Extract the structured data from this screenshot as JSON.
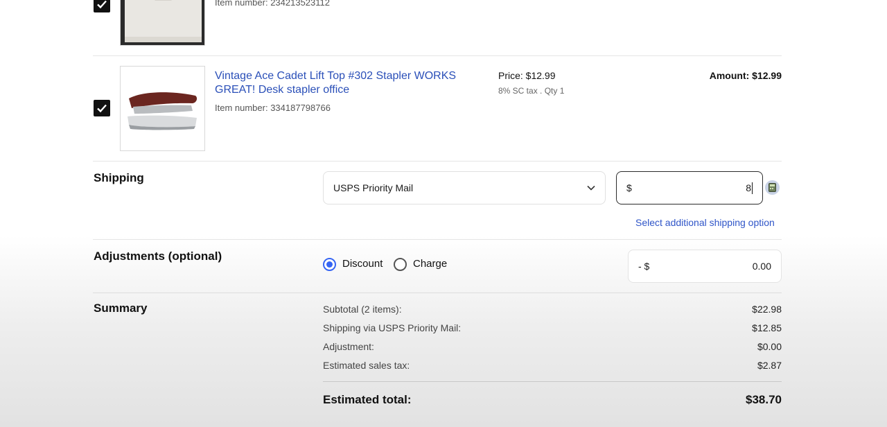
{
  "items": [
    {
      "item_number": "Item number: 234213523112",
      "checked": true
    },
    {
      "title": "Vintage Ace Cadet Lift Top #302 Stapler WORKS GREAT! Desk stapler office",
      "item_number": "Item number: 334187798766",
      "price": "Price: $12.99",
      "tax": "8% SC tax . Qty 1",
      "amount": "Amount: $12.99",
      "checked": true
    }
  ],
  "shipping": {
    "label": "Shipping",
    "service": "USPS Priority Mail",
    "currency": "$",
    "cost_value": "8",
    "additional_link": "Select additional shipping option"
  },
  "adjustments": {
    "label": "Adjustments (optional)",
    "discount_label": "Discount",
    "charge_label": "Charge",
    "selected": "Discount",
    "prefix": "- $",
    "value": "0.00"
  },
  "summary": {
    "label": "Summary",
    "rows": [
      {
        "label": "Subtotal (2 items):",
        "value": "$22.98"
      },
      {
        "label": "Shipping via USPS Priority Mail:",
        "value": "$12.85"
      },
      {
        "label": "Adjustment:",
        "value": "$0.00"
      },
      {
        "label": "Estimated sales tax:",
        "value": "$2.87"
      }
    ],
    "total_label": "Estimated total:",
    "total_value": "$38.70"
  },
  "colors": {
    "link": "#3665f3",
    "radio_selected": "#3665f3",
    "checkbox": "#111111"
  },
  "icons": [
    "checkmark-icon",
    "chevron-down-icon",
    "calculator-icon"
  ]
}
